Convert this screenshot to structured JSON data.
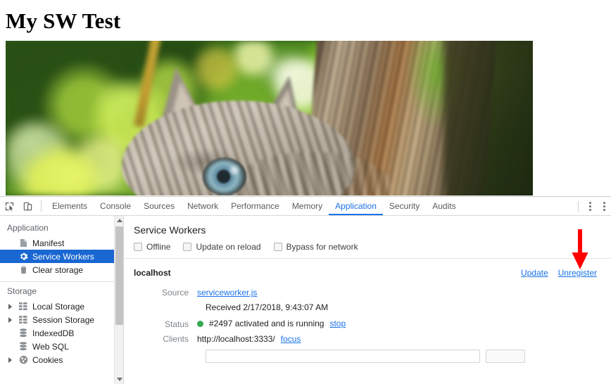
{
  "page": {
    "title": "My SW Test",
    "hero_image_alt": "kitten peeking from behind a tree trunk"
  },
  "devtools": {
    "toolbar": {
      "inspect_icon": "inspect-element-icon",
      "device_icon": "device-toolbar-icon",
      "tabs": [
        {
          "label": "Elements",
          "active": false
        },
        {
          "label": "Console",
          "active": false
        },
        {
          "label": "Sources",
          "active": false
        },
        {
          "label": "Network",
          "active": false
        },
        {
          "label": "Performance",
          "active": false
        },
        {
          "label": "Memory",
          "active": false
        },
        {
          "label": "Application",
          "active": true
        },
        {
          "label": "Security",
          "active": false
        },
        {
          "label": "Audits",
          "active": false
        }
      ],
      "menu_icon": "more-vertical-icon",
      "close_menu_icon": "more-vertical-icon"
    },
    "sidebar": {
      "groups": [
        {
          "title": "Application",
          "items": [
            {
              "label": "Manifest",
              "icon": "manifest-file-icon",
              "selected": false,
              "twisty": false
            },
            {
              "label": "Service Workers",
              "icon": "gear-icon",
              "selected": true,
              "twisty": false
            },
            {
              "label": "Clear storage",
              "icon": "trash-icon",
              "selected": false,
              "twisty": false
            }
          ]
        },
        {
          "title": "Storage",
          "items": [
            {
              "label": "Local Storage",
              "icon": "table-grid-icon",
              "selected": false,
              "twisty": true
            },
            {
              "label": "Session Storage",
              "icon": "table-grid-icon",
              "selected": false,
              "twisty": true
            },
            {
              "label": "IndexedDB",
              "icon": "database-icon",
              "selected": false,
              "twisty": false
            },
            {
              "label": "Web SQL",
              "icon": "database-icon",
              "selected": false,
              "twisty": false
            },
            {
              "label": "Cookies",
              "icon": "cookie-icon",
              "selected": false,
              "twisty": true
            }
          ]
        }
      ]
    },
    "main": {
      "heading": "Service Workers",
      "options": [
        {
          "label": "Offline",
          "checked": false
        },
        {
          "label": "Update on reload",
          "checked": false
        },
        {
          "label": "Bypass for network",
          "checked": false
        }
      ],
      "registration": {
        "origin": "localhost",
        "update_label": "Update",
        "unregister_label": "Unregister",
        "source_label": "Source",
        "source_file": "serviceworker.js",
        "received_text": "Received 2/17/2018, 9:43:07 AM",
        "status_label": "Status",
        "status_text": "#2497 activated and is running",
        "status_color": "#36a852",
        "stop_label": "stop",
        "clients_label": "Clients",
        "client_url": "http://localhost:3333/",
        "focus_label": "focus",
        "push_value": "",
        "push_placeholder": "",
        "push_button_label": ""
      }
    }
  },
  "annotation": {
    "arrow_color": "#ff0000",
    "arrow_points_to": "Unregister"
  }
}
